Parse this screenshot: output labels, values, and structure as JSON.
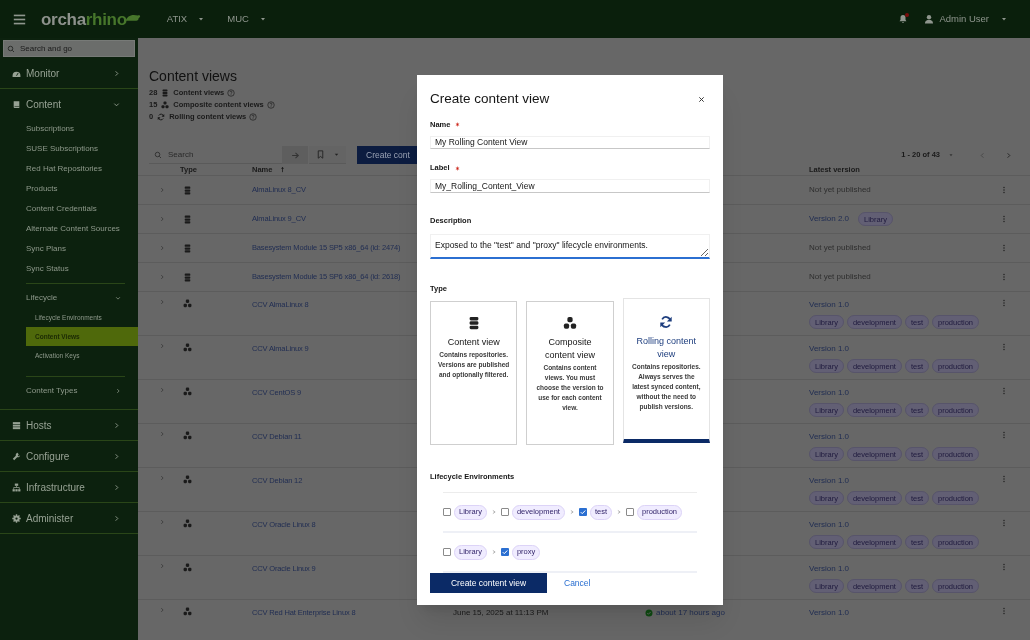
{
  "topbar": {
    "logo": [
      "orcha",
      "rhino"
    ],
    "organization": "ATIX",
    "location": "MUC",
    "notifications_unread": true,
    "user": "Admin User"
  },
  "sidebar": {
    "search_placeholder": "Search and go",
    "items": [
      {
        "label": "Monitor",
        "expanded": false
      },
      {
        "label": "Content",
        "expanded": true,
        "children": [
          {
            "label": "Subscriptions",
            "selected": false
          },
          {
            "label": "SUSE Subscriptions",
            "selected": false
          },
          {
            "label": "Red Hat Repositories",
            "selected": false
          },
          {
            "label": "Products",
            "selected": false
          },
          {
            "label": "Content Credentials",
            "selected": false
          },
          {
            "label": "Alternate Content Sources",
            "selected": false
          },
          {
            "label": "Sync Plans",
            "selected": false
          },
          {
            "label": "Sync Status",
            "selected": false
          },
          {
            "label": "Lifecycle",
            "expanded": true,
            "children": [
              {
                "label": "Lifecycle Environments",
                "selected": false
              },
              {
                "label": "Content Views",
                "selected": true
              },
              {
                "label": "Activation Keys",
                "selected": false
              }
            ]
          },
          {
            "label": "Content Types",
            "expanded": false
          }
        ]
      },
      {
        "label": "Hosts",
        "expanded": false
      },
      {
        "label": "Configure",
        "expanded": false
      },
      {
        "label": "Infrastructure",
        "expanded": false
      },
      {
        "label": "Administer",
        "expanded": false
      }
    ]
  },
  "page": {
    "title": "Content views",
    "stats": [
      {
        "count": "28",
        "kind": "content_view",
        "label": "Content views"
      },
      {
        "count": "15",
        "kind": "composite",
        "label": "Composite content views"
      },
      {
        "count": "0",
        "kind": "rolling",
        "label": "Rolling content views"
      }
    ],
    "search_placeholder": "Search",
    "create_button": "Create cont",
    "pagination": "1 - 20 of 43"
  },
  "table": {
    "columns": [
      "Type",
      "Name",
      "Latest version"
    ],
    "rows": [
      {
        "kind": "content_view",
        "name": "AlmaLinux 8_CV",
        "latest": "Not yet published"
      },
      {
        "kind": "content_view",
        "name": "AlmaLinux 9_CV",
        "version": "Version 2.0",
        "environments": [
          "Library"
        ]
      },
      {
        "kind": "content_view",
        "name": "Basesystem Module 15 SP5 x86_64 (id: 2474)",
        "latest": "Not yet published"
      },
      {
        "kind": "content_view",
        "name": "Basesystem Module 15 SP6 x86_64 (id: 2618)",
        "latest": "Not yet published"
      },
      {
        "kind": "composite",
        "name": "CCV AlmaLinux 8",
        "version": "Version 1.0",
        "environments": [
          "Library",
          "development",
          "test",
          "production"
        ]
      },
      {
        "kind": "composite",
        "name": "CCV AlmaLinux 9",
        "version": "Version 1.0",
        "environments": [
          "Library",
          "development",
          "test",
          "production"
        ]
      },
      {
        "kind": "composite",
        "name": "CCV CentOS 9",
        "version": "Version 1.0",
        "environments": [
          "Library",
          "development",
          "test",
          "production"
        ]
      },
      {
        "kind": "composite",
        "name": "CCV Debian 11",
        "version": "Version 1.0",
        "environments": [
          "Library",
          "development",
          "test",
          "production"
        ]
      },
      {
        "kind": "composite",
        "name": "CCV Debian 12",
        "version": "Version 1.0",
        "environments": [
          "Library",
          "development",
          "test",
          "production"
        ]
      },
      {
        "kind": "composite",
        "name": "CCV Oracle Linux 8",
        "version": "Version 1.0",
        "environments": [
          "Library",
          "development",
          "test",
          "production"
        ]
      },
      {
        "kind": "composite",
        "name": "CCV Oracle Linux 9",
        "version": "Version 1.0",
        "environments": [
          "Library",
          "development",
          "test",
          "production"
        ]
      },
      {
        "kind": "composite",
        "name": "CCV Red Hat Enterprise Linux 8",
        "last_published": "June 15, 2025 at 11:13 PM",
        "last_task": "about 17 hours ago",
        "version": "Version 1.0"
      }
    ]
  },
  "dialog": {
    "title": "Create content view",
    "name": {
      "label": "Name",
      "required": true,
      "value": "My Rolling Content View"
    },
    "label": {
      "label": "Label",
      "required": true,
      "value": "My_Rolling_Content_View"
    },
    "description": {
      "label": "Description",
      "value": "Exposed to the \"test\" and \"proxy\" lifecycle environments."
    },
    "type_label": "Type",
    "type_options": [
      {
        "kind": "content_view",
        "title": "Content view",
        "description": "Contains repositories. Versions are published and optionally filtered.",
        "selected": false
      },
      {
        "kind": "composite",
        "title": "Composite content view",
        "description": "Contains content views. You must choose the version to use for each content view.",
        "selected": false
      },
      {
        "kind": "rolling",
        "title": "Rolling content view",
        "description": "Contains repositories. Always serves the latest synced content, without the need to publish versions.",
        "selected": true
      }
    ],
    "environments_label": "Lifecycle Environments",
    "environment_paths": [
      [
        {
          "name": "Library",
          "checked": false
        },
        {
          "name": "development",
          "checked": false
        },
        {
          "name": "test",
          "checked": true
        },
        {
          "name": "production",
          "checked": false
        }
      ],
      [
        {
          "name": "Library",
          "checked": false
        },
        {
          "name": "proxy",
          "checked": true
        }
      ]
    ],
    "submit": "Create content view",
    "cancel": "Cancel"
  }
}
